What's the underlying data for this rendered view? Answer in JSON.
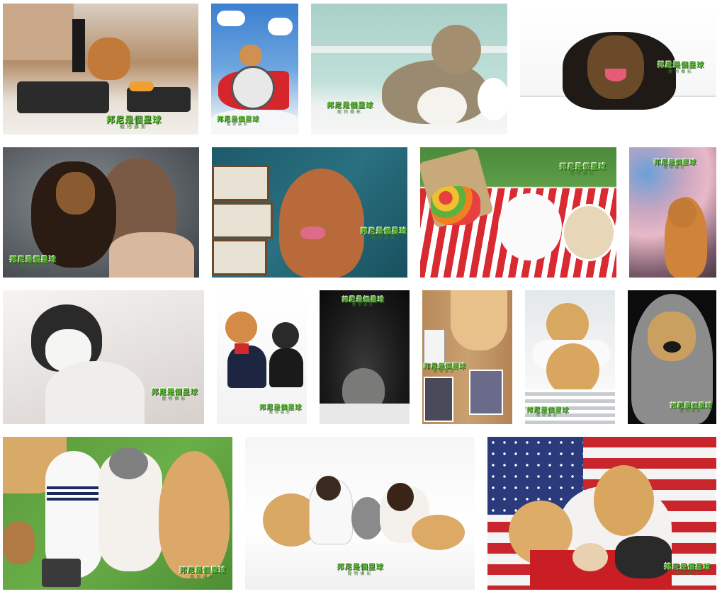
{
  "gallery": {
    "watermark_main": "邦尼是個星球",
    "watermark_sub": "寵物攝影",
    "colors": {
      "watermark_green": "#5fbf3a",
      "watermark_dark": "#2a4a1a"
    },
    "photos": [
      {
        "subject": "shiba-inu-sushi-icon"
      },
      {
        "subject": "shiba-inu-airplane-icon"
      },
      {
        "subject": "tabby-cat-icon"
      },
      {
        "subject": "dachshund-bathtub-icon"
      },
      {
        "subject": "dachshund-owner-icon"
      },
      {
        "subject": "poodle-chalkboard-icon"
      },
      {
        "subject": "pomeranian-picnic-icon"
      },
      {
        "subject": "orange-cat-blossoms-icon"
      },
      {
        "subject": "tuxedo-cat-icon"
      },
      {
        "subject": "cats-costumes-icon"
      },
      {
        "subject": "cat-dark-portrait-icon"
      },
      {
        "subject": "golden-retriever-magazines-icon"
      },
      {
        "subject": "golden-retrievers-bed-icon"
      },
      {
        "subject": "golden-retriever-scarf-icon"
      },
      {
        "subject": "couple-dogs-grass-icon"
      },
      {
        "subject": "couple-dogs-studio-icon"
      },
      {
        "subject": "golden-retrievers-flag-icon"
      }
    ]
  }
}
